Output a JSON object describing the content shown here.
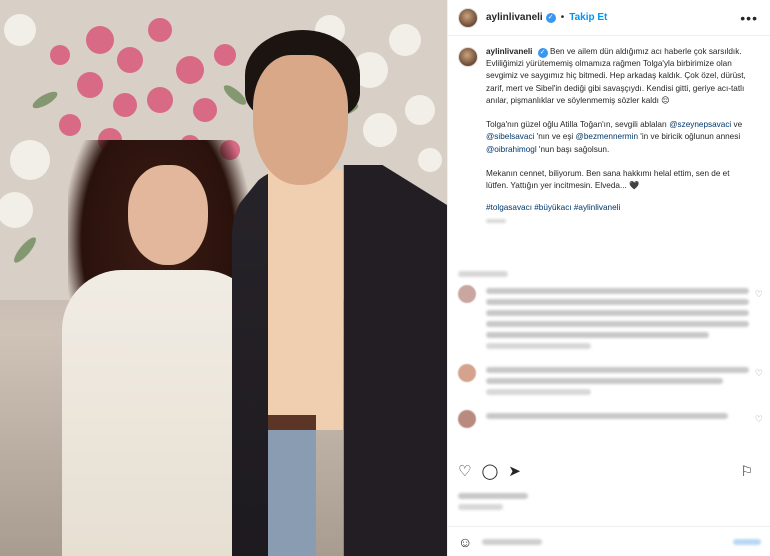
{
  "post": {
    "username": "aylinlivaneli",
    "follow_label": "Takip Et",
    "more_icon": "•••",
    "caption": {
      "p1": "Ben ve ailem dün aldığımız acı haberle çok sarsıldık. Evliliğimizi yürütememiş olmamıza rağmen Tolga'yla birbirimize olan sevgimiz ve saygımız hiç bitmedi. Hep arkadaş kaldık. Çok özel, dürüst, zarif, mert ve Sibel'in dediği gibi savaşçıydı. Kendisi gitti, geriye acı-tatlı anılar, pişmanlıklar ve söylenmemiş sözler kaldı 😔",
      "p2_a": "Tolga'nın güzel oğlu Atilla Toğan'ın, sevgili ablaları ",
      "mention1": "@szeynepsavaci",
      "p2_b": " ve ",
      "mention2": "@sibelsavaci",
      "p2_c": " 'nın ve eşi ",
      "mention3": "@bezmennermin",
      "p2_d": " 'in ve biricik oğlunun annesi ",
      "mention4": "@oibrahimogl",
      "p2_e": " 'nun başı sağolsun.",
      "p3": "Mekanın cennet, biliyorum. Ben sana hakkımı helal ettim, sen de et lütfen. Yattığın yer incitmesin. Elveda... 🖤",
      "tags": "#tolgasavacı #büyükacı #aylinlivaneli"
    }
  },
  "colors": {
    "link": "#00376b",
    "follow": "#0095f6",
    "verified": "#3897f0"
  },
  "icons": {
    "heart": "♡",
    "comment": "◯",
    "share": "➤",
    "save": "⚐",
    "emoji": "☺"
  }
}
